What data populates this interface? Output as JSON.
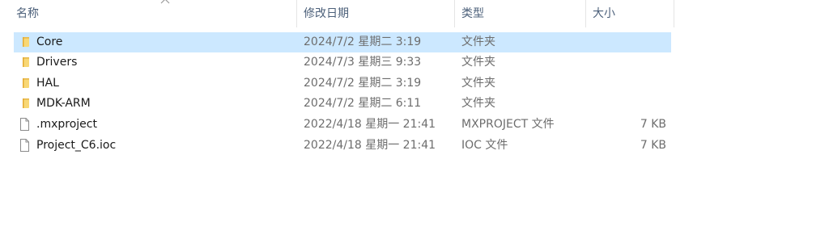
{
  "columns": {
    "name": "名称",
    "modified": "修改日期",
    "type": "类型",
    "size": "大小"
  },
  "sort": {
    "column": "name",
    "direction": "ascending",
    "icon": "chevron-up-icon"
  },
  "colors": {
    "selected_row": "#cce8ff",
    "folder": "#f8d775",
    "header_text": "#4c607a"
  },
  "rows": [
    {
      "name": "Core",
      "modified": "2024/7/2 星期二 3:19",
      "type": "文件夹",
      "size": "",
      "icon": "folder-icon",
      "selected": true
    },
    {
      "name": "Drivers",
      "modified": "2024/7/3 星期三 9:33",
      "type": "文件夹",
      "size": "",
      "icon": "folder-icon",
      "selected": false
    },
    {
      "name": "HAL",
      "modified": "2024/7/2 星期二 3:19",
      "type": "文件夹",
      "size": "",
      "icon": "folder-icon",
      "selected": false
    },
    {
      "name": "MDK-ARM",
      "modified": "2024/7/2 星期二 6:11",
      "type": "文件夹",
      "size": "",
      "icon": "folder-icon",
      "selected": false
    },
    {
      "name": ".mxproject",
      "modified": "2022/4/18 星期一 21:41",
      "type": "MXPROJECT 文件",
      "size": "7 KB",
      "icon": "file-icon",
      "selected": false
    },
    {
      "name": "Project_C6.ioc",
      "modified": "2022/4/18 星期一 21:41",
      "type": "IOC 文件",
      "size": "7 KB",
      "icon": "file-icon",
      "selected": false
    }
  ]
}
